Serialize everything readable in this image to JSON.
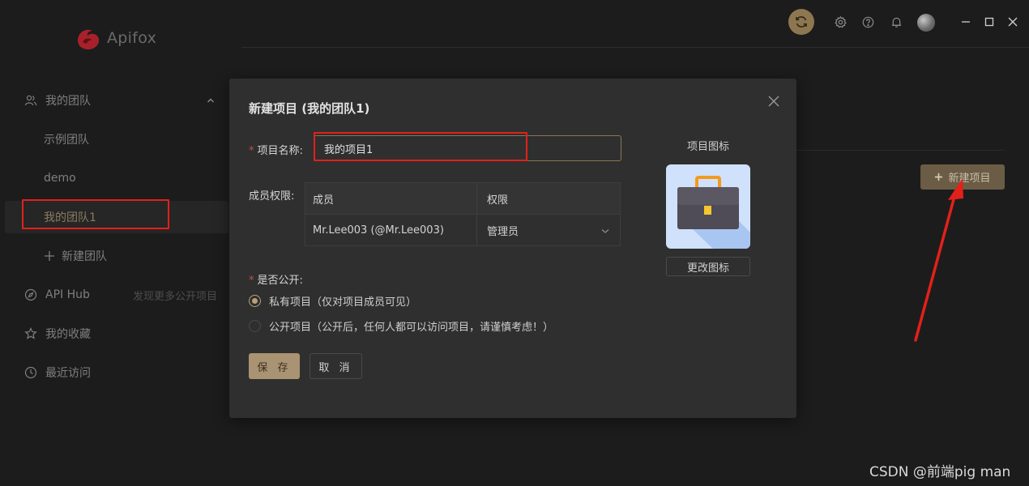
{
  "app": {
    "name": "Apifox"
  },
  "sidebar": {
    "team_header": "我的团队",
    "teams": [
      {
        "label": "示例团队"
      },
      {
        "label": "demo"
      },
      {
        "label": "我的团队1"
      }
    ],
    "new_team": "新建团队",
    "api_hub": "API Hub",
    "api_hub_hint": "发现更多公开项目",
    "favorites": "我的收藏",
    "recent": "最近访问"
  },
  "main": {
    "new_project_button": "新建项目"
  },
  "modal": {
    "title": "新建项目 (我的团队1)",
    "name_label": "项目名称:",
    "name_value": "我的项目1",
    "member_label": "成员权限:",
    "table": {
      "headers": [
        "成员",
        "权限"
      ],
      "rows": [
        {
          "member": "Mr.Lee003 (@Mr.Lee003)",
          "role": "管理员"
        }
      ]
    },
    "public_label": "是否公开:",
    "options": [
      {
        "label": "私有项目（仅对项目成员可见）",
        "selected": true
      },
      {
        "label": "公开项目（公开后，任何人都可以访问项目，请谨慎考虑！）",
        "selected": false
      }
    ],
    "save": "保 存",
    "cancel": "取 消",
    "icon_title": "项目图标",
    "change_icon": "更改图标"
  },
  "watermark": "CSDN @前端pig man",
  "colors": {
    "accent": "#a99372",
    "highlight_red": "#e3201a"
  }
}
